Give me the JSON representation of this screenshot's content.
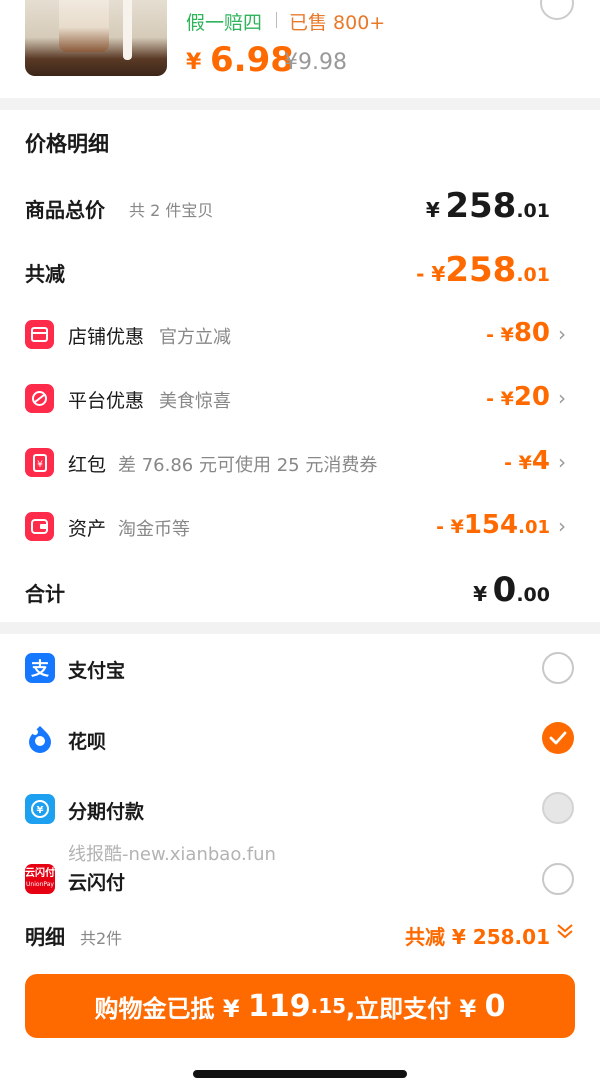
{
  "product": {
    "tag_guarantee": "假一赔四",
    "tag_sold": "已售 800+",
    "price_currency": "¥",
    "price": "6.98",
    "price_original": "¥9.98"
  },
  "price_detail": {
    "title": "价格明细",
    "total": {
      "label": "商品总价",
      "sub": "共 2 件宝贝",
      "currency": "¥",
      "int": "258",
      "dec": ".01"
    },
    "reduction": {
      "label": "共减",
      "prefix": "- ¥",
      "int": "258",
      "dec": ".01"
    },
    "discounts": [
      {
        "icon": "shop-coupon-icon",
        "label": "店铺优惠",
        "sub": "官方立减",
        "prefix": "- ¥",
        "int": "80",
        "dec": ""
      },
      {
        "icon": "platform-coupon-icon",
        "label": "平台优惠",
        "sub": "美食惊喜",
        "prefix": "- ¥",
        "int": "20",
        "dec": ""
      },
      {
        "icon": "red-envelope-icon",
        "label": "红包",
        "sub": "差 76.86 元可使用 25 元消费券",
        "prefix": "- ¥",
        "int": "4",
        "dec": ""
      },
      {
        "icon": "assets-icon",
        "label": "资产",
        "sub": "淘金币等",
        "prefix": "- ¥",
        "int": "154",
        "dec": ".01"
      }
    ],
    "sum": {
      "label": "合计",
      "currency": "¥",
      "int": "0",
      "dec": ".00"
    }
  },
  "payment_methods": [
    {
      "icon": "alipay-icon",
      "label": "支付宝",
      "state": "unchecked"
    },
    {
      "icon": "huabei-icon",
      "label": "花呗",
      "state": "checked"
    },
    {
      "icon": "installment-icon",
      "label": "分期付款",
      "state": "disabled"
    },
    {
      "icon": "unionpay-icon",
      "label": "云闪付",
      "state": "unchecked",
      "icon_text": "云闪付",
      "icon_subtext": "UnionPay"
    }
  ],
  "watermark": "线报酷-new.xianbao.fun",
  "detail": {
    "label": "明细",
    "count": "共2件",
    "discount": "共减 ¥ 258.01"
  },
  "pay_button": {
    "part1": "购物金已抵 ¥ ",
    "amount_int": "119",
    "amount_dec": ".15",
    "part2": ",立即支付 ¥ ",
    "pay_amount": "0"
  },
  "colors": {
    "accent": "#ff6a00",
    "discount_icon": "#ff2b4a",
    "alipay": "#1677ff",
    "tag_green": "#2fb35b"
  }
}
